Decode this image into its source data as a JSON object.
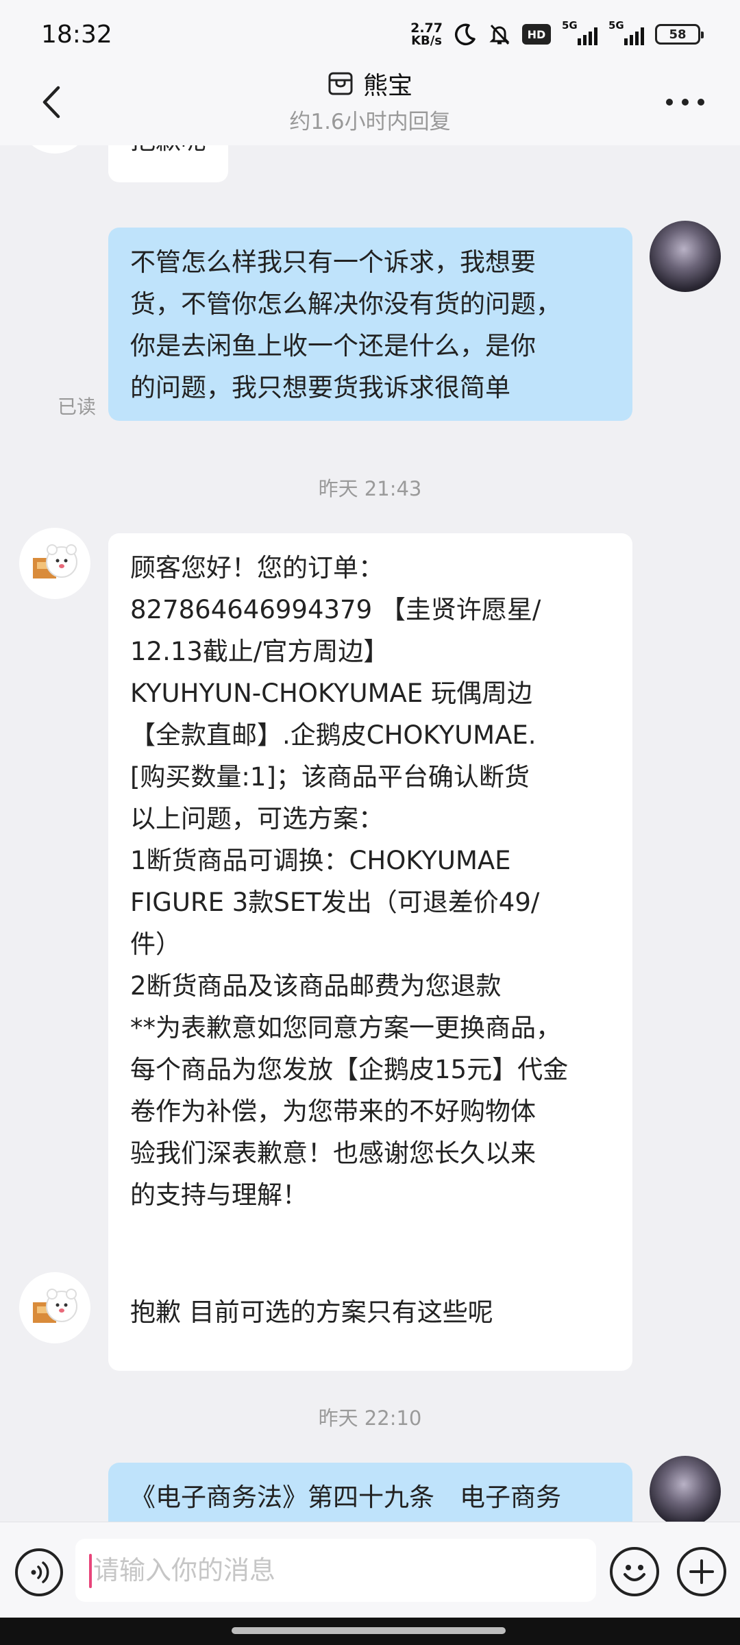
{
  "status_bar": {
    "time": "18:32",
    "net_speed_value": "2.77",
    "net_speed_unit": "KB/s",
    "icons": [
      "moon-icon",
      "mute-bell-icon",
      "hd-icon",
      "signal-5g-icon",
      "signal-5g-icon"
    ],
    "hd_label": "HD",
    "network_1": "5G",
    "network_2": "5G",
    "battery": "58"
  },
  "header": {
    "title": "熊宝",
    "subtitle": "约1.6小时内回复",
    "back_icon": "chevron-left-icon",
    "shop_icon": "shop-icon",
    "more_icon": "more-dots-icon"
  },
  "chat": {
    "messages": [
      {
        "from": "shop",
        "text": "抱歉呢"
      },
      {
        "from": "me",
        "text": "不管怎么样我只有一个诉求，我想要\n货，不管你怎么解决你没有货的问题，\n你是去闲鱼上收一个还是什么，是你\n的问题，我只想要货我诉求很简单",
        "status": "已读"
      },
      {
        "type": "timestamp",
        "text": "昨天 21:43"
      },
      {
        "from": "shop",
        "text": "顾客您好！您的订单：\n827864646994379 【圭贤许愿星/\n12.13截止/官方周边】\nKYUHYUN-CHOKYUMAE 玩偶周边\n【全款直邮】.企鹅皮CHOKYUMAE.\n[购买数量:1]；该商品平台确认断货\n以上问题，可选方案：\n1断货商品可调换：CHOKYUMAE\nFIGURE 3款SET发出（可退差价49/\n件）\n2断货商品及该商品邮费为您退款\n**为表歉意如您同意方案一更换商品，\n每个商品为您发放【企鹅皮15元】代金\n卷作为补偿，为您带来的不好购物体\n验我们深表歉意！也感谢您长久以来\n的支持与理解！"
      },
      {
        "from": "shop",
        "text": "抱歉 目前可选的方案只有这些呢"
      },
      {
        "type": "timestamp",
        "text": "昨天 22:10"
      },
      {
        "from": "me",
        "text": "《电子商务法》第四十九条　电子商务"
      }
    ]
  },
  "composer": {
    "placeholder": "请输入你的消息",
    "voice_icon": "voice-icon",
    "emoji_icon": "emoji-icon",
    "plus_icon": "plus-icon"
  }
}
